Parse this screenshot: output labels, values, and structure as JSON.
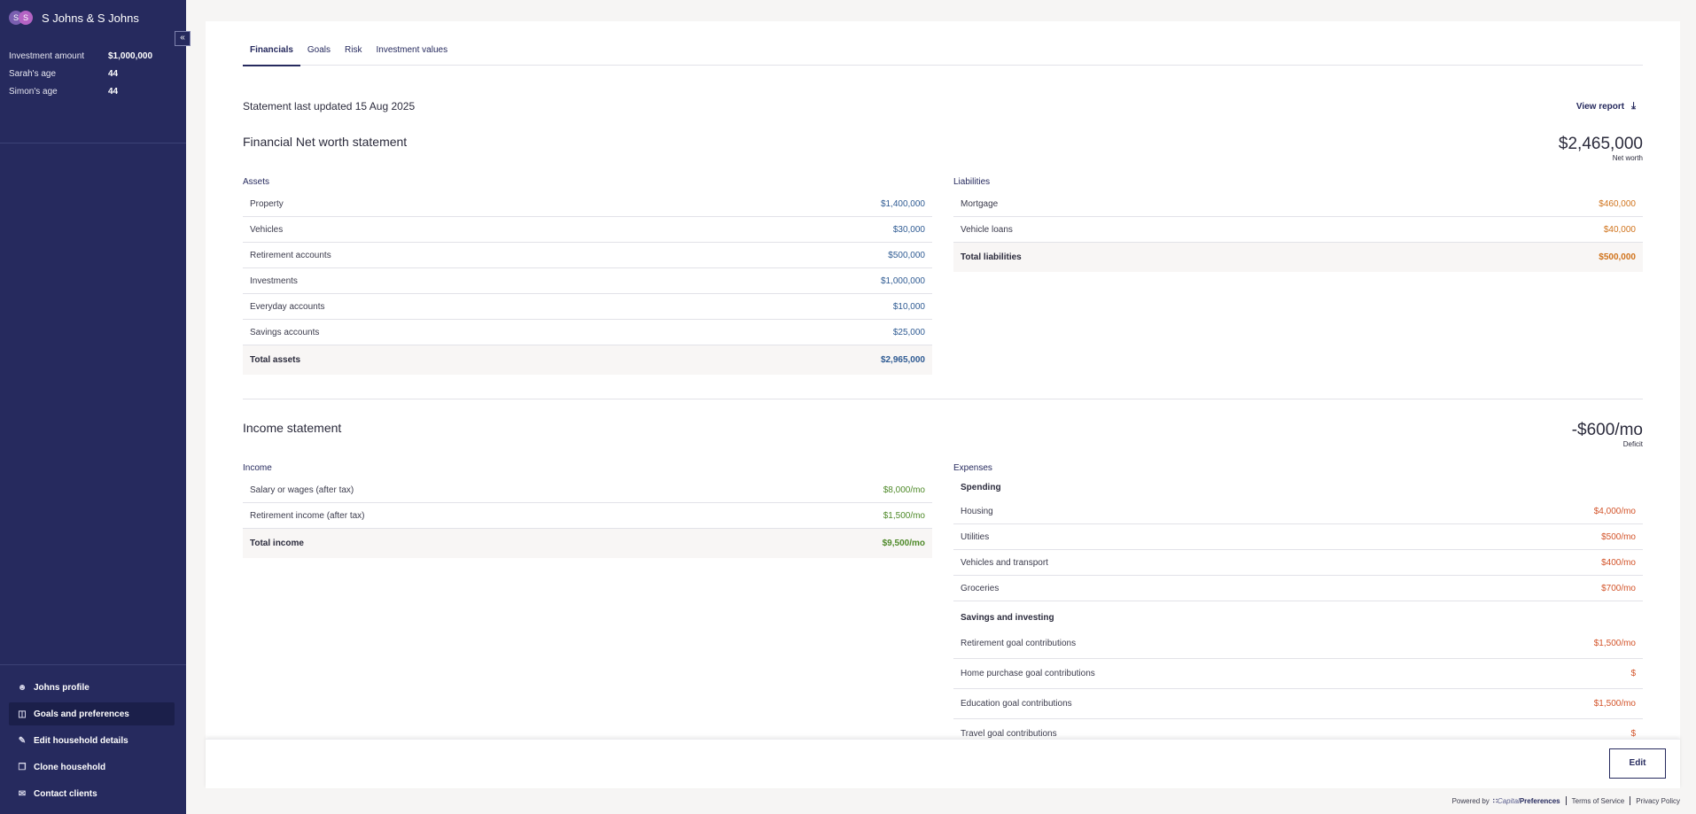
{
  "sidebar": {
    "avatars": [
      "S",
      "S"
    ],
    "title": "S Johns & S Johns",
    "info": [
      {
        "label": "Investment amount",
        "value": "$1,000,000"
      },
      {
        "label": "Sarah's age",
        "value": "44"
      },
      {
        "label": "Simon's age",
        "value": "44"
      }
    ],
    "collapse_label": "«",
    "nav": [
      {
        "label": "Johns profile",
        "icon": "person-icon"
      },
      {
        "label": "Goals and preferences",
        "icon": "columns-icon",
        "active": true
      },
      {
        "label": "Edit household details",
        "icon": "pencil-icon"
      },
      {
        "label": "Clone household",
        "icon": "copy-icon"
      },
      {
        "label": "Contact clients",
        "icon": "mail-icon"
      }
    ]
  },
  "tabs": [
    "Financials",
    "Goals",
    "Risk",
    "Investment values"
  ],
  "statement_updated": "Statement last updated 15 Aug 2025",
  "view_report": "View report",
  "networth": {
    "title": "Financial Net worth statement",
    "value": "$2,465,000",
    "value_label": "Net worth",
    "assets_title": "Assets",
    "assets": [
      {
        "label": "Property",
        "value": "$1,400,000"
      },
      {
        "label": "Vehicles",
        "value": "$30,000"
      },
      {
        "label": "Retirement accounts",
        "value": "$500,000"
      },
      {
        "label": "Investments",
        "value": "$1,000,000"
      },
      {
        "label": "Everyday accounts",
        "value": "$10,000"
      },
      {
        "label": "Savings accounts",
        "value": "$25,000"
      }
    ],
    "assets_total": {
      "label": "Total assets",
      "value": "$2,965,000"
    },
    "liabilities_title": "Liabilities",
    "liabilities": [
      {
        "label": "Mortgage",
        "value": "$460,000"
      },
      {
        "label": "Vehicle loans",
        "value": "$40,000"
      }
    ],
    "liabilities_total": {
      "label": "Total liabilities",
      "value": "$500,000"
    }
  },
  "income_statement": {
    "title": "Income statement",
    "value": "-$600/mo",
    "value_label": "Deficit",
    "income_title": "Income",
    "income": [
      {
        "label": "Salary or wages (after tax)",
        "value": "$8,000/mo"
      },
      {
        "label": "Retirement income (after tax)",
        "value": "$1,500/mo"
      }
    ],
    "income_total": {
      "label": "Total income",
      "value": "$9,500/mo"
    },
    "expenses_title": "Expenses",
    "spending_title": "Spending",
    "spending": [
      {
        "label": "Housing",
        "value": "$4,000/mo"
      },
      {
        "label": "Utilities",
        "value": "$500/mo"
      },
      {
        "label": "Vehicles and transport",
        "value": "$400/mo"
      },
      {
        "label": "Groceries",
        "value": "$700/mo"
      }
    ],
    "saving_title": "Savings and investing",
    "saving": [
      {
        "label": "Retirement goal contributions",
        "value": "$1,500/mo"
      },
      {
        "label": "Home purchase goal contributions",
        "value": "$"
      },
      {
        "label": "Education goal contributions",
        "value": "$1,500/mo"
      },
      {
        "label": "Travel goal contributions",
        "value": "$"
      }
    ]
  },
  "actions": {
    "edit": "Edit"
  },
  "footer": {
    "powered_by": "Powered by",
    "brand_prefix": "Capital",
    "brand_suffix": "Preferences",
    "terms": "Terms of Service",
    "privacy": "Privacy Policy"
  },
  "colors": {
    "sidebar": "#262a5e",
    "asset_value": "#2f5b93",
    "liability_value": "#d0731c",
    "income_value": "#4f8a2a",
    "expense_value": "#d3542a"
  }
}
